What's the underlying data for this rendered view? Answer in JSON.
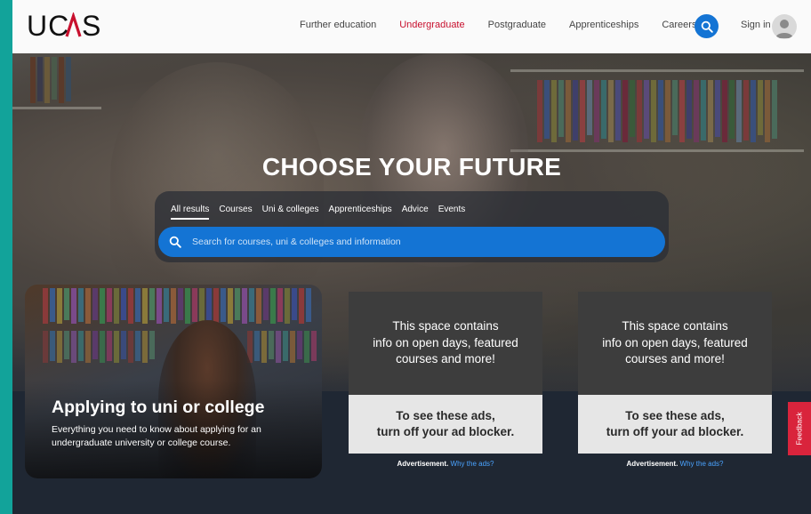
{
  "header": {
    "logo": "UCAS",
    "nav": [
      "Further education",
      "Undergraduate",
      "Postgraduate",
      "Apprenticeships",
      "Careers"
    ],
    "active_nav": "Undergraduate",
    "sign_in": "Sign in"
  },
  "hero": {
    "title": "CHOOSE YOUR FUTURE",
    "tabs": [
      "All results",
      "Courses",
      "Uni & colleges",
      "Apprenticeships",
      "Advice",
      "Events"
    ],
    "selected_tab": "All results",
    "search_placeholder": "Search for courses, uni & colleges and information"
  },
  "feature_card": {
    "title": "Applying to uni or college",
    "description": "Everything you need to know about applying for an undergraduate university or college course."
  },
  "ads": [
    {
      "top_lines": [
        "This space contains",
        "info on open days, featured",
        "courses and more!"
      ],
      "bottom_lines": [
        "To see these ads,",
        "turn off your ad blocker."
      ],
      "note": "Advertisement.",
      "note_link": "Why the ads?"
    },
    {
      "top_lines": [
        "This space contains",
        "info on open days, featured",
        "courses and more!"
      ],
      "bottom_lines": [
        "To see these ads,",
        "turn off your ad blocker."
      ],
      "note": "Advertisement.",
      "note_link": "Why the ads?"
    }
  ],
  "feedback": "Feedback",
  "colors": {
    "brand_red": "#c8102e",
    "accent_blue": "#1474d4",
    "frame_teal": "#12a39a",
    "page_dark": "#1f2733",
    "feedback_red": "#d9243c"
  }
}
